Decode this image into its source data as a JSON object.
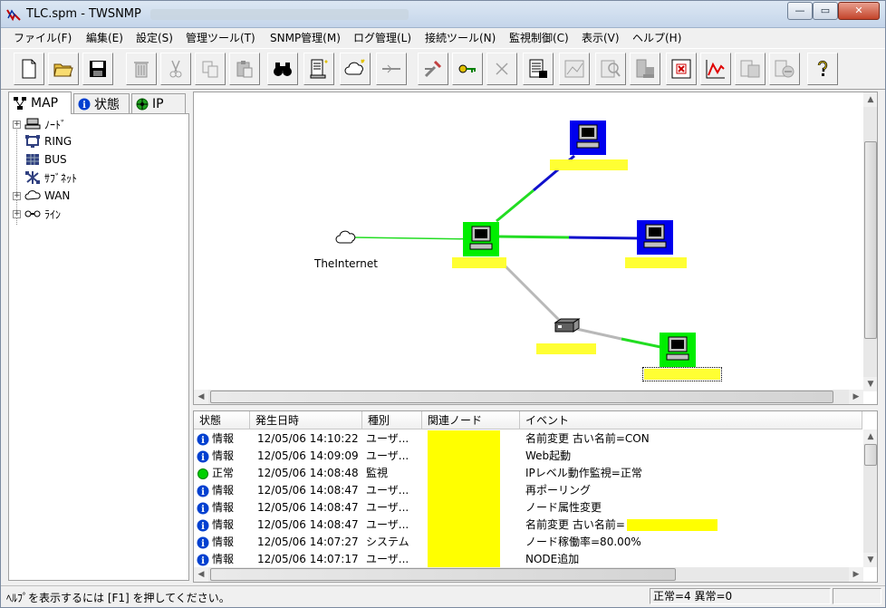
{
  "window": {
    "title": "TLC.spm - TWSNMP",
    "minimize_glyph": "—",
    "restore_glyph": "▭",
    "close_glyph": "✕"
  },
  "menu": [
    "ファイル(F)",
    "編集(E)",
    "設定(S)",
    "管理ツール(T)",
    "SNMP管理(M)",
    "ログ管理(L)",
    "接続ツール(N)",
    "監視制御(C)",
    "表示(V)",
    "ヘルプ(H)"
  ],
  "toolbar": [
    "new-file-icon",
    "open-folder-icon",
    "save-icon",
    "trash-icon",
    "cut-icon",
    "copy-icon",
    "paste-icon",
    "find-binoculars-icon",
    "add-node-icon",
    "add-network-cloud-icon",
    "add-line-icon",
    "tools-icon",
    "key-icon",
    "delete-x-icon",
    "report-icon",
    "map-view-icon",
    "search-node-icon",
    "server-icon",
    "alert-stop-icon",
    "chart-line-icon",
    "log-doc-icon",
    "ie-icon",
    "help-icon"
  ],
  "left_tabs": {
    "map": "MAP",
    "status": "状態",
    "ip": "IP"
  },
  "tree": [
    {
      "label": "ﾉｰﾄﾞ",
      "expandable": true,
      "icon": "node-icon"
    },
    {
      "label": "RING",
      "expandable": false,
      "icon": "ring-icon"
    },
    {
      "label": "BUS",
      "expandable": false,
      "icon": "bus-icon"
    },
    {
      "label": "ｻﾌﾞﾈｯﾄ",
      "expandable": false,
      "icon": "subnet-icon"
    },
    {
      "label": "WAN",
      "expandable": true,
      "icon": "wan-icon"
    },
    {
      "label": "ﾗｲﾝ",
      "expandable": true,
      "icon": "line-icon"
    }
  ],
  "map": {
    "internet_label": "TheInternet",
    "colors": {
      "normal": "#00ee00",
      "warn": "#0000ee",
      "link_green": "#22dd22",
      "link_blue": "#1010cc",
      "link_gray": "#b8b8b8",
      "label_highlight": "#ffff33"
    }
  },
  "events": {
    "columns": [
      "状態",
      "発生日時",
      "種別",
      "関連ノード",
      "イベント"
    ],
    "rows": [
      {
        "status": "情報",
        "status_icon": "info-icon",
        "time": "12/05/06 14:10:22",
        "type": "ユーザ...",
        "event": "名前変更 古い名前=CON"
      },
      {
        "status": "情報",
        "status_icon": "info-icon",
        "time": "12/05/06 14:09:09",
        "type": "ユーザ...",
        "event": "Web起動"
      },
      {
        "status": "正常",
        "status_icon": "normal-dot-icon",
        "time": "12/05/06 14:08:48",
        "type": "監視",
        "event": "IPレベル動作監視=正常"
      },
      {
        "status": "情報",
        "status_icon": "info-icon",
        "time": "12/05/06 14:08:47",
        "type": "ユーザ...",
        "event": "再ポーリング"
      },
      {
        "status": "情報",
        "status_icon": "info-icon",
        "time": "12/05/06 14:08:47",
        "type": "ユーザ...",
        "event": "ノード属性変更"
      },
      {
        "status": "情報",
        "status_icon": "info-icon",
        "time": "12/05/06 14:08:47",
        "type": "ユーザ...",
        "event": "名前変更 古い名前="
      },
      {
        "status": "情報",
        "status_icon": "info-icon",
        "time": "12/05/06 14:07:27",
        "type": "システム",
        "event": "ノード稼働率=80.00%"
      },
      {
        "status": "情報",
        "status_icon": "info-icon",
        "time": "12/05/06 14:07:17",
        "type": "ユーザ...",
        "event": "NODE追加"
      }
    ]
  },
  "statusbar": {
    "help_text": "ﾍﾙﾌﾟを表示するには [F1] を押してください。",
    "counts": "正常=4 異常=0"
  }
}
